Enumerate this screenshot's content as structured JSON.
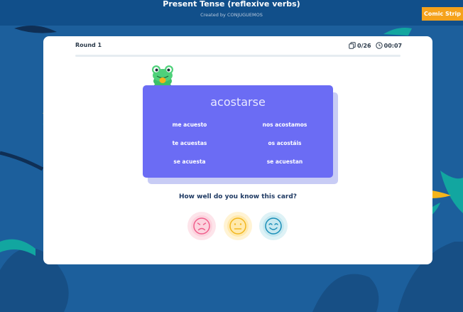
{
  "header": {
    "title": "Present Tense (reflexive verbs)",
    "subtitle": "Created by CONJUGUEMOS",
    "comic_strip_label": "Comic Strip"
  },
  "game": {
    "round_label": "Round 1",
    "card_count": "0/26",
    "timer": "00:07",
    "progress": 0
  },
  "flashcard": {
    "verb": "acostarse",
    "conjugations": {
      "yo": "me acuesto",
      "nosotros": "nos acostamos",
      "tu": "te acuestas",
      "vosotros": "os acostáis",
      "el": "se acuesta",
      "ellos": "se acuestan"
    }
  },
  "rating": {
    "question": "How well do you know this card?",
    "options": [
      "sad-face-icon",
      "neutral-face-icon",
      "happy-face-icon"
    ]
  },
  "colors": {
    "background": "#1c5f9c",
    "accent_orange": "#f5a21b",
    "card_purple": "#6b6cf4",
    "sad": "#f05f8c",
    "neutral": "#f3b71f",
    "happy": "#1b8fb8"
  }
}
